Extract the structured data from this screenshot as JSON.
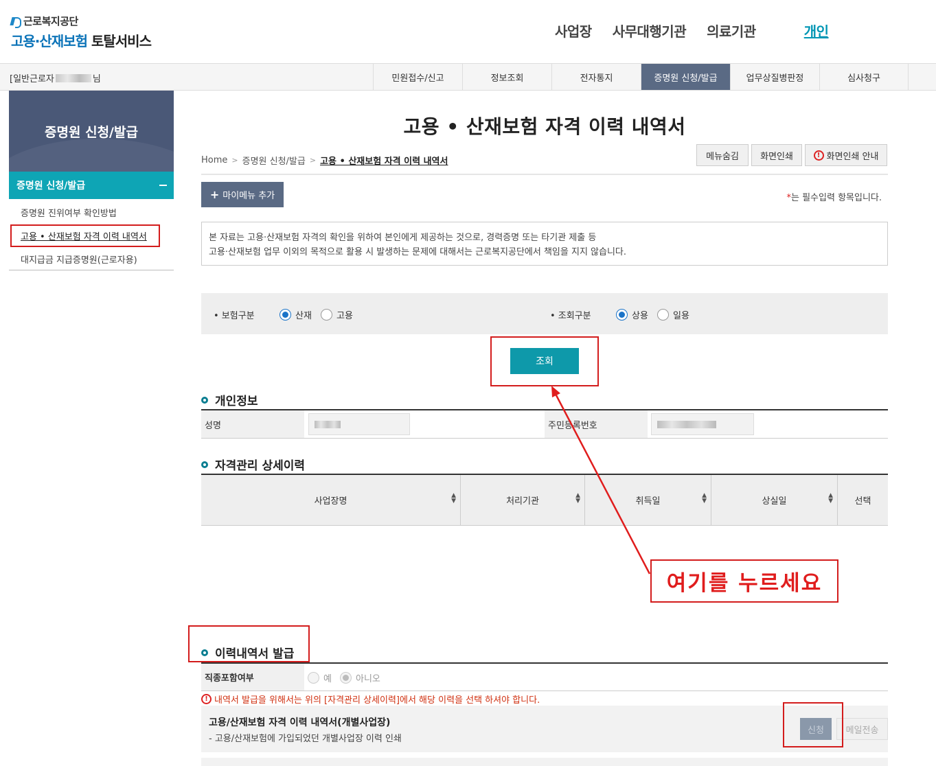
{
  "header": {
    "org": "근로복지공단",
    "service_blue": "고용·산재보험",
    "service_dark": "토탈서비스",
    "gnb": [
      "사업장",
      "사무대행기관",
      "의료기관",
      "개인"
    ]
  },
  "navbar": {
    "user_prefix": "[일반근로자",
    "user_suffix": "님",
    "tabs": [
      "민원접수/신고",
      "정보조회",
      "전자통지",
      "증명원 신청/발급",
      "업무상질병판정",
      "심사청구"
    ]
  },
  "sidebar": {
    "title": "증명원 신청/발급",
    "category": "증명원 신청/발급",
    "items": [
      "증명원 진위여부 확인방법",
      "고용 • 산재보험 자격 이력 내역서",
      "대지급금 지급증명원(근로자용)"
    ]
  },
  "page": {
    "title": "고용 • 산재보험 자격 이력 내역서",
    "breadcrumb": [
      "Home",
      "증명원 신청/발급",
      "고용 • 산재보험 자격 이력 내역서"
    ],
    "buttons": {
      "hide_menu": "메뉴숨김",
      "print": "화면인쇄",
      "print_guide": "화면인쇄 안내"
    },
    "mymenu": "마이메뉴 추가",
    "required_note": "는 필수입력 항목입니다.",
    "notice_lines": [
      "본 자료는 고용·산재보험 자격의 확인을 위하여 본인에게 제공하는 것으로, 경력증명 또는 타기관 제출 등",
      "고용·산재보험 업무 이외의 목적으로 활용 시 발생하는 문제에 대해서는 근로복지공단에서 책임을 지지 않습니다."
    ]
  },
  "search": {
    "insurance_label": "• 보험구분",
    "insurance_options": [
      "산재",
      "고용"
    ],
    "insurance_selected": "산재",
    "inquiry_label": "• 조회구분",
    "inquiry_options": [
      "상용",
      "일용"
    ],
    "inquiry_selected": "상용",
    "query_button": "조회"
  },
  "personal": {
    "section_title": "개인정보",
    "name_label": "성명",
    "rrn_label": "주민등록번호"
  },
  "history": {
    "section_title": "자격관리 상세이력",
    "columns": [
      "사업장명",
      "처리기관",
      "취득일",
      "상실일",
      "선택"
    ]
  },
  "callout": "여기를 누르세요",
  "issue": {
    "section_title": "이력내역서 발급",
    "option_label": "직종포함여부",
    "options": [
      "예",
      "아니오"
    ],
    "option_selected": "아니오",
    "warning": "내역서 발급을 위해서는 위의 [자격관리 상세이력]에서 해당 이력을 선택 하셔야 합니다.",
    "doc_title": "고용/산재보험 자격 이력 내역서(개별사업장)",
    "doc_desc": "- 고용/산재보험에 가입되었던 개별사업장 이력 인쇄",
    "apply_button": "신청",
    "mail_button": "메일전송"
  },
  "colors": {
    "accent": "#0e99aa",
    "nav_active": "#5a6a84",
    "highlight": "#d31c1c"
  }
}
